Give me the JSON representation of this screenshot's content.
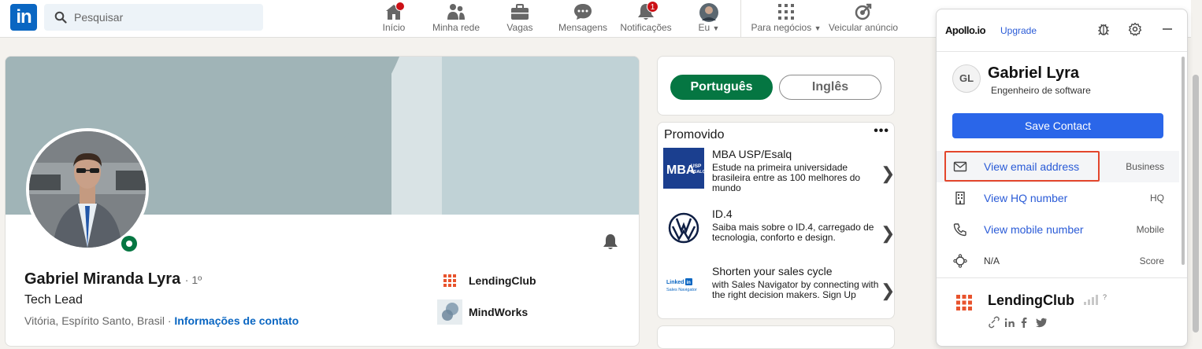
{
  "search": {
    "placeholder": "Pesquisar"
  },
  "nav": {
    "home": "Início",
    "network": "Minha rede",
    "jobs": "Vagas",
    "messages": "Mensagens",
    "notifications": "Notificações",
    "notifications_badge": "1",
    "me": "Eu",
    "business": "Para negócios",
    "ads": "Veicular anúncio"
  },
  "profile": {
    "name": "Gabriel Miranda Lyra",
    "degree": "· 1º",
    "headline": "Tech Lead",
    "location": "Vitória, Espírito Santo, Brasil ·",
    "contact_link": "Informações de contato",
    "companies": [
      {
        "name": "LendingClub"
      },
      {
        "name": "MindWorks"
      }
    ]
  },
  "languages": {
    "active": "Português",
    "inactive": "Inglês"
  },
  "promo": {
    "title": "Promovido",
    "more": "•••",
    "ads": [
      {
        "title": "MBA USP/Esalq",
        "desc": "Estude na primeira universidade brasileira entre as 100 melhores do mundo",
        "logo_text": "MBA",
        "logo_sub": "USP\nESALQ"
      },
      {
        "title": "ID.4",
        "desc": "Saiba mais sobre o ID.4, carregado de tecnologia, conforto e design.",
        "logo_text": "VW"
      },
      {
        "title": "Shorten your sales cycle",
        "desc": "with Sales Navigator by connecting with the right decision makers. Sign Up",
        "logo_text": "Linked in",
        "logo_sub": "Sales Navigator"
      }
    ],
    "chevron": "❯"
  },
  "apollo": {
    "brand": "Apollo.io",
    "upgrade": "Upgrade",
    "initials": "GL",
    "name": "Gabriel Lyra",
    "title": "Engenheiro de software",
    "save": "Save Contact",
    "rows": [
      {
        "label": "View email address",
        "tag": "Business"
      },
      {
        "label": "View HQ number",
        "tag": "HQ"
      },
      {
        "label": "View mobile number",
        "tag": "Mobile"
      },
      {
        "label": "N/A",
        "tag": "Score"
      }
    ],
    "company": "LendingClub",
    "company_signal": "?"
  },
  "colors": {
    "linkedin_blue": "#0a66c2",
    "linkedin_green": "#057642",
    "apollo_blue": "#2a66e9",
    "focus_red": "#e3462c"
  }
}
